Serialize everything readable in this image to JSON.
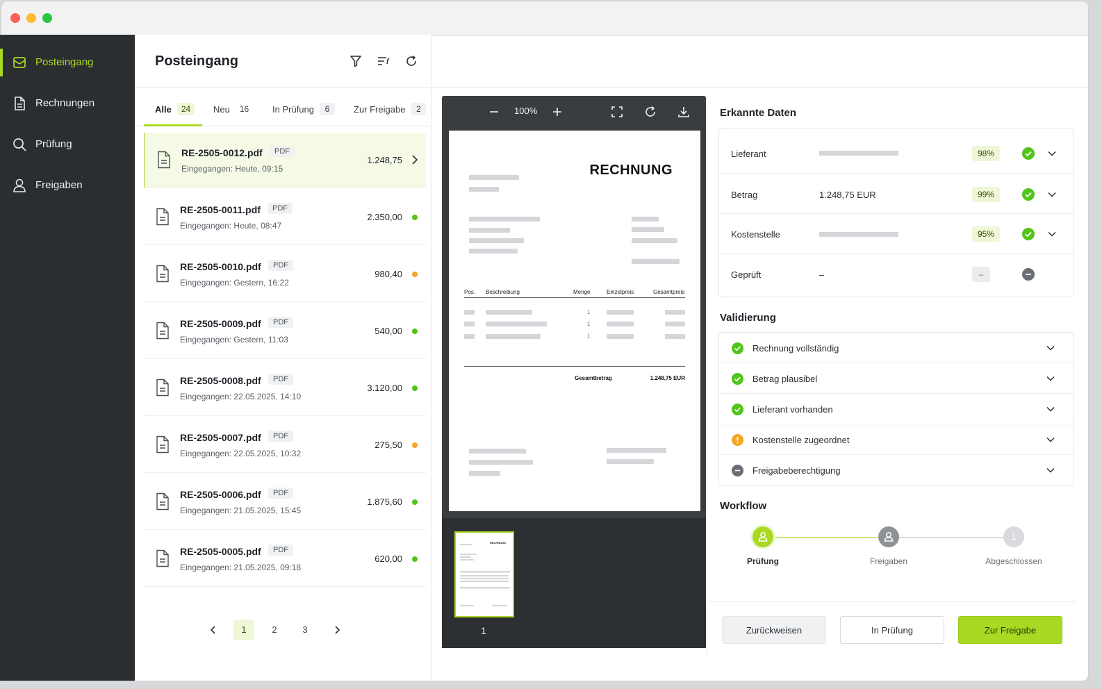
{
  "colors": {
    "accent": "#a9d923",
    "sidebar_bg": "#2b2e31",
    "status_green": "#52c41a",
    "status_orange": "#f5a623",
    "status_gray": "#6a6f75"
  },
  "sidebar": {
    "items": [
      {
        "label": "Posteingang",
        "icon": "mail-icon",
        "active": true
      },
      {
        "label": "Rechnungen",
        "icon": "document-icon",
        "active": false
      },
      {
        "label": "Prüfung",
        "icon": "search-icon",
        "active": false
      },
      {
        "label": "Freigaben",
        "icon": "user-icon",
        "active": false
      }
    ]
  },
  "list": {
    "title": "Posteingang",
    "tabs": [
      {
        "label": "Alle",
        "count": "24"
      },
      {
        "label": "Neu",
        "count": "16"
      },
      {
        "label": "In Prüfung",
        "count": "6"
      },
      {
        "label": "Zur Freigabe",
        "count": "2"
      }
    ],
    "files": [
      {
        "name": "RE-2505-0012.pdf",
        "type": "PDF",
        "received": "Eingegangen: Heute, 09:15",
        "amount": "1.248,75",
        "status": "selected"
      },
      {
        "name": "RE-2505-0011.pdf",
        "type": "PDF",
        "received": "Eingegangen: Heute, 08:47",
        "amount": "2.350,00",
        "status": "green"
      },
      {
        "name": "RE-2505-0010.pdf",
        "type": "PDF",
        "received": "Eingegangen: Gestern, 16:22",
        "amount": "980,40",
        "status": "orange"
      },
      {
        "name": "RE-2505-0009.pdf",
        "type": "PDF",
        "received": "Eingegangen: Gestern, 11:03",
        "amount": "540,00",
        "status": "green"
      },
      {
        "name": "RE-2505-0008.pdf",
        "type": "PDF",
        "received": "Eingegangen: 22.05.2025, 14:10",
        "amount": "3.120,00",
        "status": "green"
      },
      {
        "name": "RE-2505-0007.pdf",
        "type": "PDF",
        "received": "Eingegangen: 22.05.2025, 10:32",
        "amount": "275,50",
        "status": "orange"
      },
      {
        "name": "RE-2505-0006.pdf",
        "type": "PDF",
        "received": "Eingegangen: 21.05.2025, 15:45",
        "amount": "1.875,60",
        "status": "green"
      },
      {
        "name": "RE-2505-0005.pdf",
        "type": "PDF",
        "received": "Eingegangen: 21.05.2025, 09:18",
        "amount": "620,00",
        "status": "green"
      }
    ],
    "pagination": {
      "pages": [
        "1",
        "2",
        "3"
      ],
      "current": "1"
    }
  },
  "viewer": {
    "zoom": "100%",
    "document": {
      "title": "RECHNUNG",
      "columns": [
        "Pos.",
        "Beschreibung",
        "Menge",
        "Einzelpreis",
        "Gesamtpreis"
      ],
      "quantities": [
        "1",
        "1",
        "1"
      ],
      "total_label": "Gesamtbetrag",
      "total_value": "1.248,75 EUR"
    },
    "thumbnail": {
      "title": "RECHNUNG",
      "page": "1"
    }
  },
  "recognized": {
    "title": "Erkannte Daten",
    "rows": [
      {
        "label": "Lieferant",
        "value": "",
        "confidence": "98%",
        "status": "ok"
      },
      {
        "label": "Betrag",
        "value": "1.248,75 EUR",
        "confidence": "99%",
        "status": "ok"
      },
      {
        "label": "Kostenstelle",
        "value": "",
        "confidence": "95%",
        "status": "ok"
      },
      {
        "label": "Geprüft",
        "value": "–",
        "confidence": "–",
        "status": "neutral"
      }
    ]
  },
  "validation": {
    "title": "Validierung",
    "items": [
      {
        "label": "Rechnung vollständig",
        "status": "ok"
      },
      {
        "label": "Betrag plausibel",
        "status": "ok"
      },
      {
        "label": "Lieferant vorhanden",
        "status": "ok"
      },
      {
        "label": "Kostenstelle zugeordnet",
        "status": "warning"
      },
      {
        "label": "Freigabeberechtigung",
        "status": "neutral"
      }
    ]
  },
  "workflow": {
    "title": "Workflow",
    "steps": [
      {
        "label": "Prüfung",
        "state": "active"
      },
      {
        "label": "Freigaben",
        "state": "pending"
      },
      {
        "label": "Abgeschlossen",
        "state": "upcoming",
        "number": "1"
      }
    ]
  },
  "actions": {
    "reject": "Zurückweisen",
    "review": "In Prüfung",
    "approve": "Zur Freigabe"
  }
}
